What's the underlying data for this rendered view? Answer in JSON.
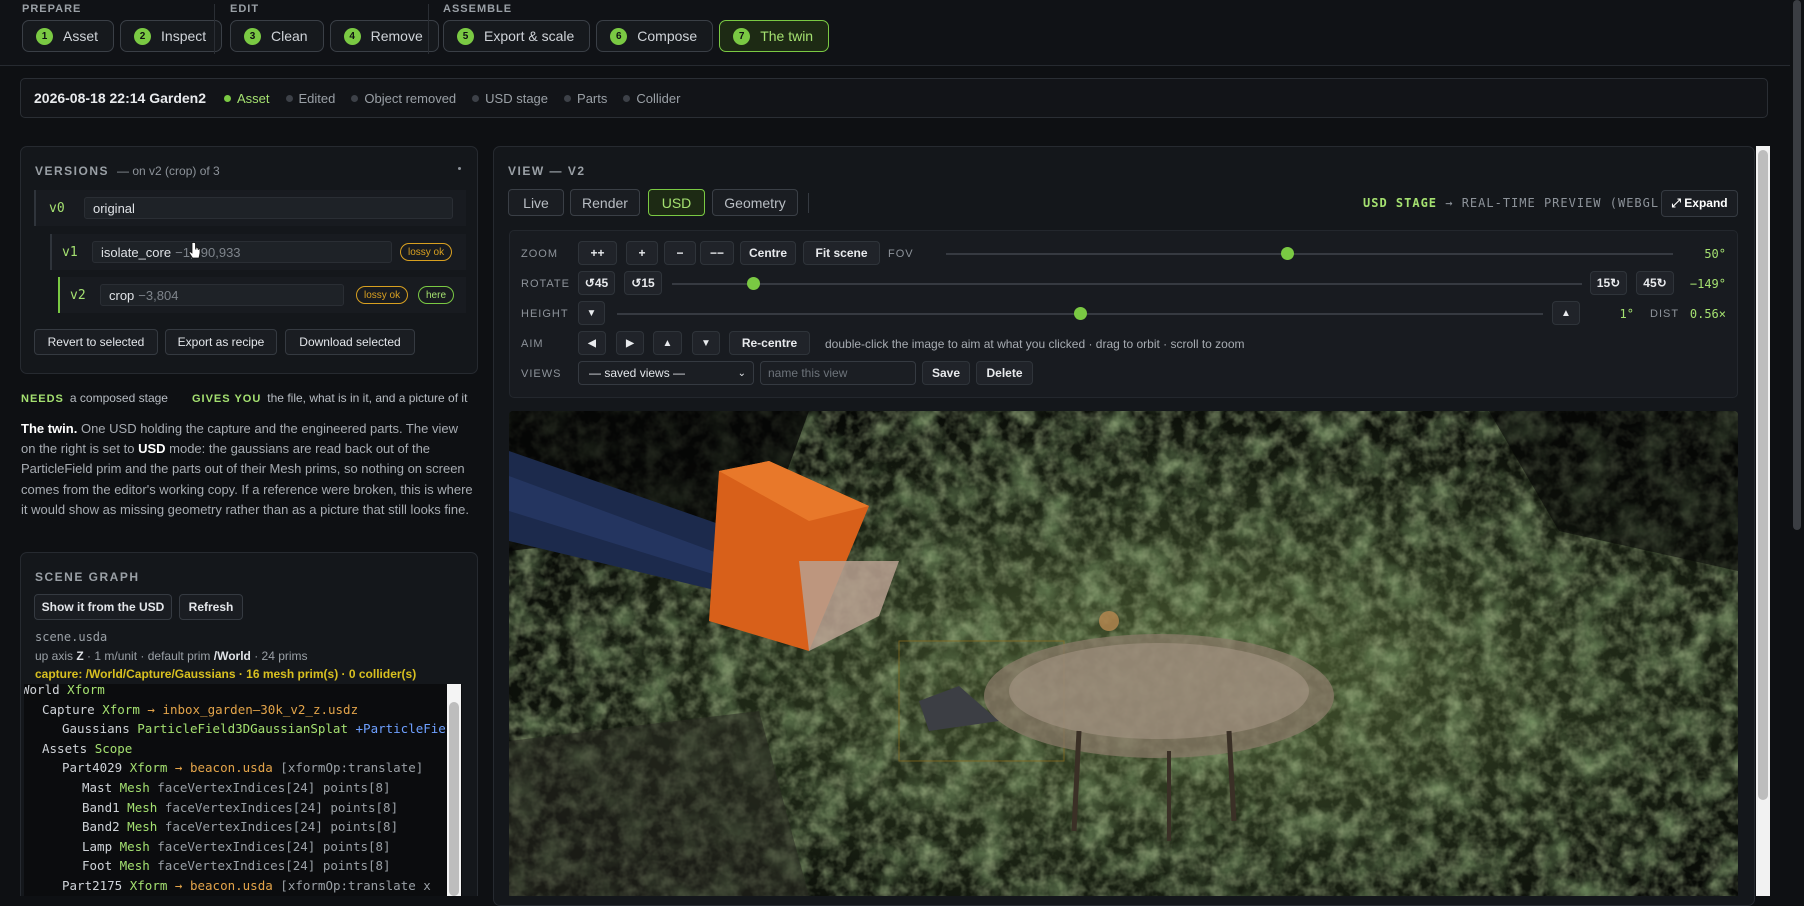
{
  "steps": {
    "prepare_label": "PREPARE",
    "edit_label": "EDIT",
    "assemble_label": "ASSEMBLE",
    "items": [
      {
        "num": "1",
        "label": "Asset"
      },
      {
        "num": "2",
        "label": "Inspect"
      },
      {
        "num": "3",
        "label": "Clean"
      },
      {
        "num": "4",
        "label": "Remove"
      },
      {
        "num": "5",
        "label": "Export & scale"
      },
      {
        "num": "6",
        "label": "Compose"
      },
      {
        "num": "7",
        "label": "The twin"
      }
    ],
    "active_index": 6
  },
  "status": {
    "title": "2026-08-18 22:14 Garden2",
    "pills": [
      "Asset",
      "Edited",
      "Object removed",
      "USD stage",
      "Parts",
      "Collider"
    ],
    "active_pill": "Asset"
  },
  "versions": {
    "heading": "VERSIONS",
    "subheading": "— on v2 (crop) of 3",
    "items": [
      {
        "id": "v0",
        "name": "original",
        "delta": ""
      },
      {
        "id": "v1",
        "name": "isolate_core",
        "delta": "−1,390,933",
        "tag": "lossy ok"
      },
      {
        "id": "v2",
        "name": "crop",
        "delta": "−3,804",
        "tag": "lossy ok",
        "here": "here"
      }
    ],
    "buttons": {
      "revert": "Revert to selected",
      "export": "Export as recipe",
      "download": "Download selected"
    }
  },
  "needs": {
    "needs_label": "NEEDS",
    "needs_text": "a composed stage",
    "gives_label": "GIVES YOU",
    "gives_text": "the file, what is in it, and a picture of it"
  },
  "description": {
    "lead": "The twin.",
    "part1": " One USD holding the capture and the engineered parts. The view on the right is set to ",
    "mode": "USD",
    "part2": " mode: the gaussians are read back out of the ParticleField prim and the parts out of their Mesh prims, so nothing on screen comes from the editor's working copy. If a reference were broken, this is where it would show as missing geometry rather than as a picture that still looks fine."
  },
  "scene_graph": {
    "heading": "SCENE GRAPH",
    "show_button": "Show it from the USD",
    "refresh_button": "Refresh",
    "file": "scene.usda",
    "meta_prefix": "up axis ",
    "meta_axis": "Z",
    "meta_mid": " · 1 m/unit · default prim ",
    "meta_prim": "/World",
    "meta_suffix": " · 24 prims",
    "capture_line": "capture: /World/Capture/Gaussians · 16 mesh prim(s) · 0 collider(s)",
    "tree": [
      {
        "indent": 0,
        "name": "World",
        "type": "Xform",
        "ref": "",
        "extra": ""
      },
      {
        "indent": 1,
        "name": "Capture",
        "type": "Xform",
        "ref": "→ inbox_garden–30k_v2_z.usdz",
        "extra": ""
      },
      {
        "indent": 2,
        "name": "Gaussians",
        "type": "ParticleField3DGaussianSplat",
        "ref": "",
        "extra": "+ParticleField"
      },
      {
        "indent": 1,
        "name": "Assets",
        "type": "Scope",
        "ref": "",
        "extra": ""
      },
      {
        "indent": 2,
        "name": "Part4029",
        "type": "Xform",
        "ref": "→ beacon.usda",
        "extra": "[xformOp:translate]"
      },
      {
        "indent": 3,
        "name": "Mast",
        "type": "Mesh",
        "ref": "",
        "extra": "faceVertexIndices[24] points[8]"
      },
      {
        "indent": 3,
        "name": "Band1",
        "type": "Mesh",
        "ref": "",
        "extra": "faceVertexIndices[24] points[8]"
      },
      {
        "indent": 3,
        "name": "Band2",
        "type": "Mesh",
        "ref": "",
        "extra": "faceVertexIndices[24] points[8]"
      },
      {
        "indent": 3,
        "name": "Lamp",
        "type": "Mesh",
        "ref": "",
        "extra": "faceVertexIndices[24] points[8]"
      },
      {
        "indent": 3,
        "name": "Foot",
        "type": "Mesh",
        "ref": "",
        "extra": "faceVertexIndices[24] points[8]"
      },
      {
        "indent": 2,
        "name": "Part2175",
        "type": "Xform",
        "ref": "→ beacon.usda",
        "extra": "[xformOp:translate x"
      }
    ]
  },
  "view": {
    "heading": "VIEW — V2",
    "tabs": [
      "Live",
      "Render",
      "USD",
      "Geometry"
    ],
    "active_tab": "USD",
    "stage_label_strong": "USD STAGE",
    "stage_label_rest": " → REAL-TIME PREVIEW (WEBGL)",
    "expand": "⤢ Expand",
    "zoom": {
      "label": "ZOOM",
      "buttons": [
        "++",
        "+",
        "−",
        "−−"
      ],
      "centre": "Centre",
      "fit": "Fit scene",
      "fov_label": "FOV",
      "fov_value": "50°",
      "fov_level": 0.47
    },
    "rotate": {
      "label": "ROTATE",
      "left45": "↺45",
      "left15": "↺15",
      "right15": "15↻",
      "right45": "45↻",
      "value": "−149°",
      "level": 0.09
    },
    "height": {
      "label": "HEIGHT",
      "down": "▼",
      "up": "▲",
      "value": "1°",
      "dist_label": "DIST",
      "dist_value": "0.56×",
      "level": 0.5
    },
    "aim": {
      "label": "AIM",
      "left": "◀",
      "right": "▶",
      "up": "▲",
      "down": "▼",
      "recentre": "Re-centre",
      "hint": "double-click the image to aim at what you clicked · drag to orbit · scroll to zoom"
    },
    "views": {
      "label": "VIEWS",
      "selected": "— saved views —",
      "name_placeholder": "name this view",
      "save": "Save",
      "delete": "Delete"
    }
  },
  "colors": {
    "accent": "#7ac943",
    "warn": "#d8a020",
    "orange_part": "#d8601a",
    "navy_part": "#1c2a4c"
  }
}
